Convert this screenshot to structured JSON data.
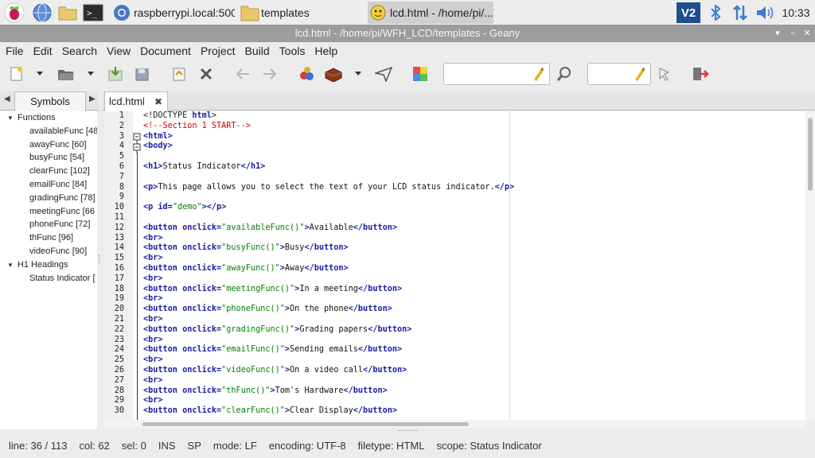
{
  "taskbar": {
    "tasks": [
      {
        "label": "raspberrypi.local:500..."
      },
      {
        "label": "templates"
      },
      {
        "label": "lcd.html - /home/pi/..."
      }
    ],
    "clock": "10:33"
  },
  "window": {
    "title": "lcd.html - /home/pi/WFH_LCD/templates - Geany"
  },
  "menu": [
    "File",
    "Edit",
    "Search",
    "View",
    "Document",
    "Project",
    "Build",
    "Tools",
    "Help"
  ],
  "sidebar": {
    "tab_label": "Symbols",
    "groups": [
      {
        "label": "Functions",
        "items": [
          "availableFunc [48",
          "awayFunc [60]",
          "busyFunc [54]",
          "clearFunc [102]",
          "emailFunc [84]",
          "gradingFunc [78]",
          "meetingFunc [66",
          "phoneFunc [72]",
          "thFunc [96]",
          "videoFunc [90]"
        ]
      },
      {
        "label": "H1 Headings",
        "items": [
          "Status Indicator ["
        ]
      }
    ]
  },
  "editor": {
    "tab_label": "lcd.html",
    "line_numbers": [
      "1",
      "2",
      "3",
      "4",
      "5",
      "6",
      "7",
      "8",
      "9",
      "10",
      "11",
      "12",
      "13",
      "14",
      "15",
      "16",
      "17",
      "18",
      "19",
      "20",
      "21",
      "22",
      "23",
      "24",
      "25",
      "26",
      "27",
      "28",
      "29",
      "30"
    ],
    "lines": [
      "<!DOCTYPE html>",
      "<!--Section 1 START-->",
      "<html>",
      "<body>",
      "",
      "<h1>Status Indicator</h1>",
      "",
      "<p>This page allows you to select the text of your LCD status indicator.</p>",
      "",
      "<p id=\"demo\"></p>",
      "",
      "<button onclick=\"availableFunc()\">Available</button>",
      "<br>",
      "<button onclick=\"busyFunc()\">Busy</button>",
      "<br>",
      "<button onclick=\"awayFunc()\">Away</button>",
      "<br>",
      "<button onclick=\"meetingFunc()\">In a meeting</button>",
      "<br>",
      "<button onclick=\"phoneFunc()\">On the phone</button>",
      "<br>",
      "<button onclick=\"gradingFunc()\">Grading papers</button>",
      "<br>",
      "<button onclick=\"emailFunc()\">Sending emails</button>",
      "<br>",
      "<button onclick=\"videoFunc()\">On a video call</button>",
      "<br>",
      "<button onclick=\"thFunc()\">Tom's Hardware</button>",
      "<br>",
      "<button onclick=\"clearFunc()\">Clear Display</button>"
    ]
  },
  "status": {
    "line": "line: 36 / 113",
    "col": "col: 62",
    "sel": "sel: 0",
    "ins": "INS",
    "sp": "SP",
    "mode": "mode: LF",
    "encoding": "encoding: UTF-8",
    "filetype": "filetype: HTML",
    "scope": "scope: Status Indicator"
  }
}
